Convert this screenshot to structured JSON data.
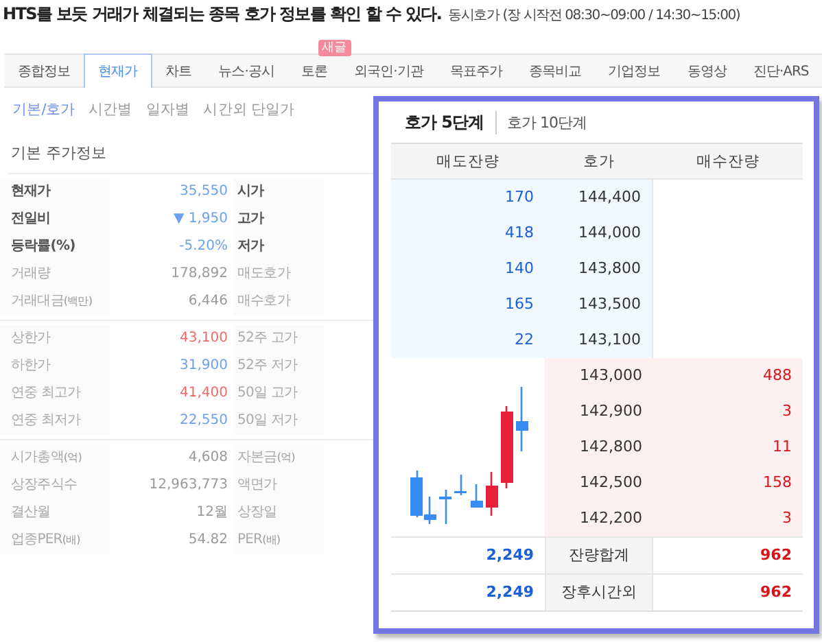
{
  "headline": {
    "title": "HTS를 보듯 거래가 체결되는 종목 호가 정보를 확인 할 수 있다.",
    "note": "동시호가 (장 시작전 08:30~09:00 / 14:30~15:00)"
  },
  "tabs": [
    {
      "label": "종합정보",
      "selected": false
    },
    {
      "label": "현재가",
      "selected": true
    },
    {
      "label": "차트",
      "selected": false
    },
    {
      "label": "뉴스·공시",
      "selected": false
    },
    {
      "label": "토론",
      "selected": false,
      "badge": "새글"
    },
    {
      "label": "외국인·기관",
      "selected": false
    },
    {
      "label": "목표주가",
      "selected": false
    },
    {
      "label": "종목비교",
      "selected": false
    },
    {
      "label": "기업정보",
      "selected": false
    },
    {
      "label": "동영상",
      "selected": false
    },
    {
      "label": "진단·ARS",
      "selected": false
    }
  ],
  "subtabs": [
    {
      "label": "기본/호가",
      "selected": true
    },
    {
      "label": "시간별",
      "selected": false
    },
    {
      "label": "일자별",
      "selected": false
    },
    {
      "label": "시간외 단일가",
      "selected": false
    }
  ],
  "price_info": {
    "title": "기본 주가정보",
    "groups": [
      [
        {
          "label": "현재가",
          "value": "35,550",
          "color": "#6b9ff0",
          "strong": true,
          "label2": "시가",
          "strong2": true
        },
        {
          "label": "전일비",
          "value": "▼ 1,950",
          "color": "#6b9ff0",
          "strong": true,
          "label2": "고가",
          "strong2": true
        },
        {
          "label": "등락률(%)",
          "value": "-5.20%",
          "color": "#6b9ff0",
          "strong": true,
          "label2": "저가",
          "strong2": true
        },
        {
          "label": "거래량",
          "value": "178,892",
          "color": "#999999",
          "strong": false,
          "label2": "매도호가",
          "strong2": false
        },
        {
          "label": "거래대금",
          "unit": "(백만)",
          "value": "6,446",
          "color": "#999999",
          "strong": false,
          "label2": "매수호가",
          "strong2": false
        }
      ],
      [
        {
          "label": "상한가",
          "value": "43,100",
          "color": "#f06a6a",
          "strong": false,
          "label2": "52주 고가",
          "strong2": false
        },
        {
          "label": "하한가",
          "value": "31,900",
          "color": "#6b9ff0",
          "strong": false,
          "label2": "52주 저가",
          "strong2": false
        },
        {
          "label": "연중 최고가",
          "value": "41,400",
          "color": "#f06a6a",
          "strong": false,
          "label2": "50일 고가",
          "strong2": false
        },
        {
          "label": "연중 최저가",
          "value": "22,550",
          "color": "#6b9ff0",
          "strong": false,
          "label2": "50일 저가",
          "strong2": false
        }
      ],
      [
        {
          "label": "시가총액",
          "unit": "(억)",
          "value": "4,608",
          "color": "#999999",
          "strong": false,
          "label2": "자본금",
          "unit2": "(억)",
          "strong2": false
        },
        {
          "label": "상장주식수",
          "value": "12,963,773",
          "color": "#999999",
          "strong": false,
          "label2": "액면가",
          "strong2": false
        },
        {
          "label": "결산월",
          "value": "12월",
          "color": "#999999",
          "strong": false,
          "label2": "상장일",
          "strong2": false
        },
        {
          "label": "업종PER",
          "unit": "(배)",
          "value": "54.82",
          "color": "#999999",
          "strong": false,
          "label2": "PER",
          "unit2": "(배)",
          "strong2": false
        }
      ]
    ]
  },
  "orderbook": {
    "tabs": [
      {
        "label": "호가 5단계",
        "selected": true
      },
      {
        "label": "호가 10단계",
        "selected": false
      }
    ],
    "columns": [
      "매도잔량",
      "호가",
      "매수잔량"
    ],
    "asks": [
      {
        "qty": "170",
        "price": "144,400"
      },
      {
        "qty": "418",
        "price": "144,000"
      },
      {
        "qty": "140",
        "price": "143,800"
      },
      {
        "qty": "165",
        "price": "143,500"
      },
      {
        "qty": "22",
        "price": "143,100"
      }
    ],
    "bids": [
      {
        "price": "143,000",
        "qty": "488"
      },
      {
        "price": "142,900",
        "qty": "3"
      },
      {
        "price": "142,800",
        "qty": "11"
      },
      {
        "price": "142,500",
        "qty": "158"
      },
      {
        "price": "142,200",
        "qty": "3"
      }
    ],
    "totals": [
      {
        "sell": "2,249",
        "label": "잔량합계",
        "buy": "962"
      },
      {
        "sell": "2,249",
        "label": "장후시간외",
        "buy": "962"
      }
    ]
  }
}
